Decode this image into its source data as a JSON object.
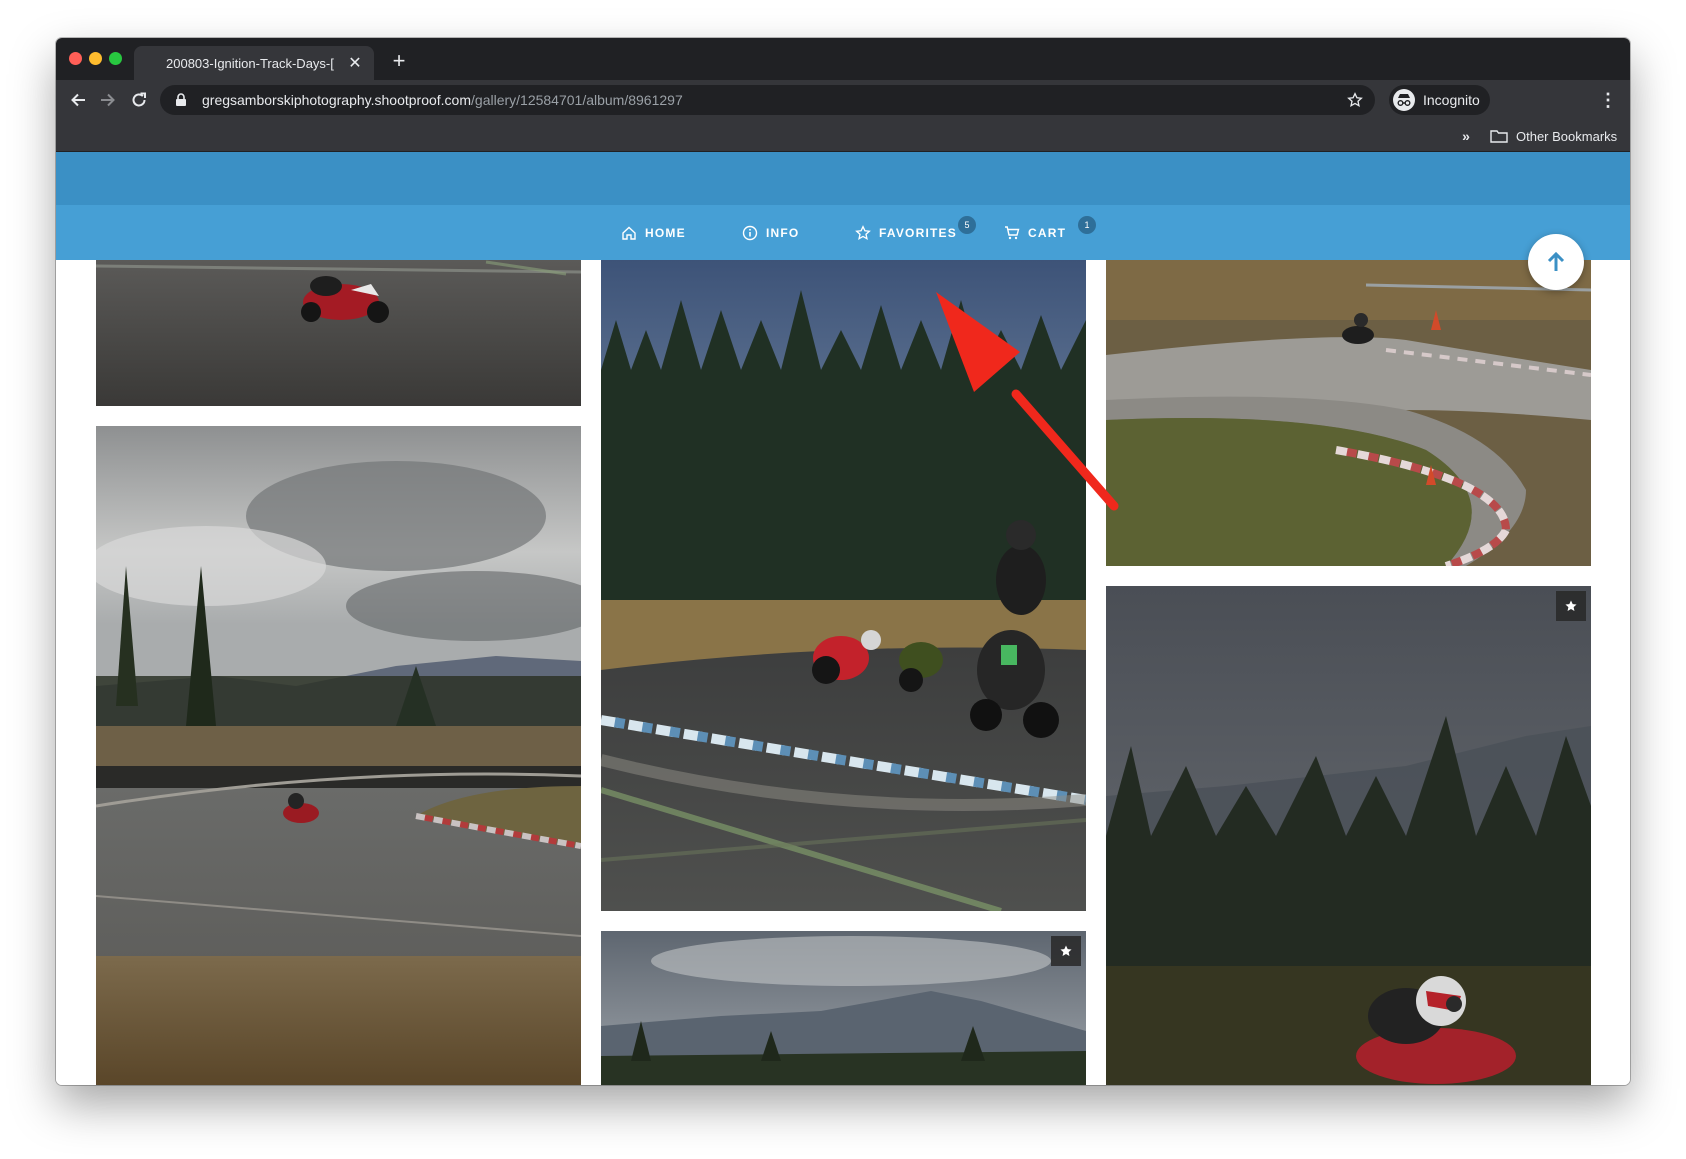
{
  "browser": {
    "tab_title": "200803-Ignition-Track-Days-[",
    "url_host": "gregsamborskiphotography.shootproof.com",
    "url_path": "/gallery/12584701/album/8961297",
    "profile_label": "Incognito",
    "bookmarks_overflow": "»",
    "other_bookmarks_label": "Other Bookmarks",
    "icons": [
      "back-icon",
      "forward-icon",
      "reload-icon",
      "lock-icon",
      "star-icon",
      "incognito-icon",
      "menu-icon",
      "folder-icon"
    ]
  },
  "site_nav": {
    "items": [
      {
        "label": "HOME",
        "icon": "home-icon"
      },
      {
        "label": "INFO",
        "icon": "info-icon"
      },
      {
        "label": "FAVORITES",
        "icon": "star-outline-icon",
        "badge": "5"
      },
      {
        "label": "CART",
        "icon": "cart-icon",
        "badge": "1"
      }
    ],
    "colors": {
      "header_band": "#3b90c5",
      "navbar": "#469fd5",
      "badge": "#2e6f99"
    }
  },
  "gallery": {
    "photos": [
      {
        "name": "motorcycle-on-track-red-sportbike",
        "favorited": false
      },
      {
        "name": "rider-on-curve-cloudy-sky",
        "favorited": false
      },
      {
        "name": "three-riders-forest-backdrop",
        "favorited": false
      },
      {
        "name": "mountain-landscape",
        "favorited": true
      },
      {
        "name": "rider-on-curved-track-grass",
        "favorited": false
      },
      {
        "name": "rider-close-up-forest",
        "favorited": true
      }
    ]
  },
  "annotation": {
    "color": "#f0281c",
    "points_to": "favorites-nav-item"
  }
}
